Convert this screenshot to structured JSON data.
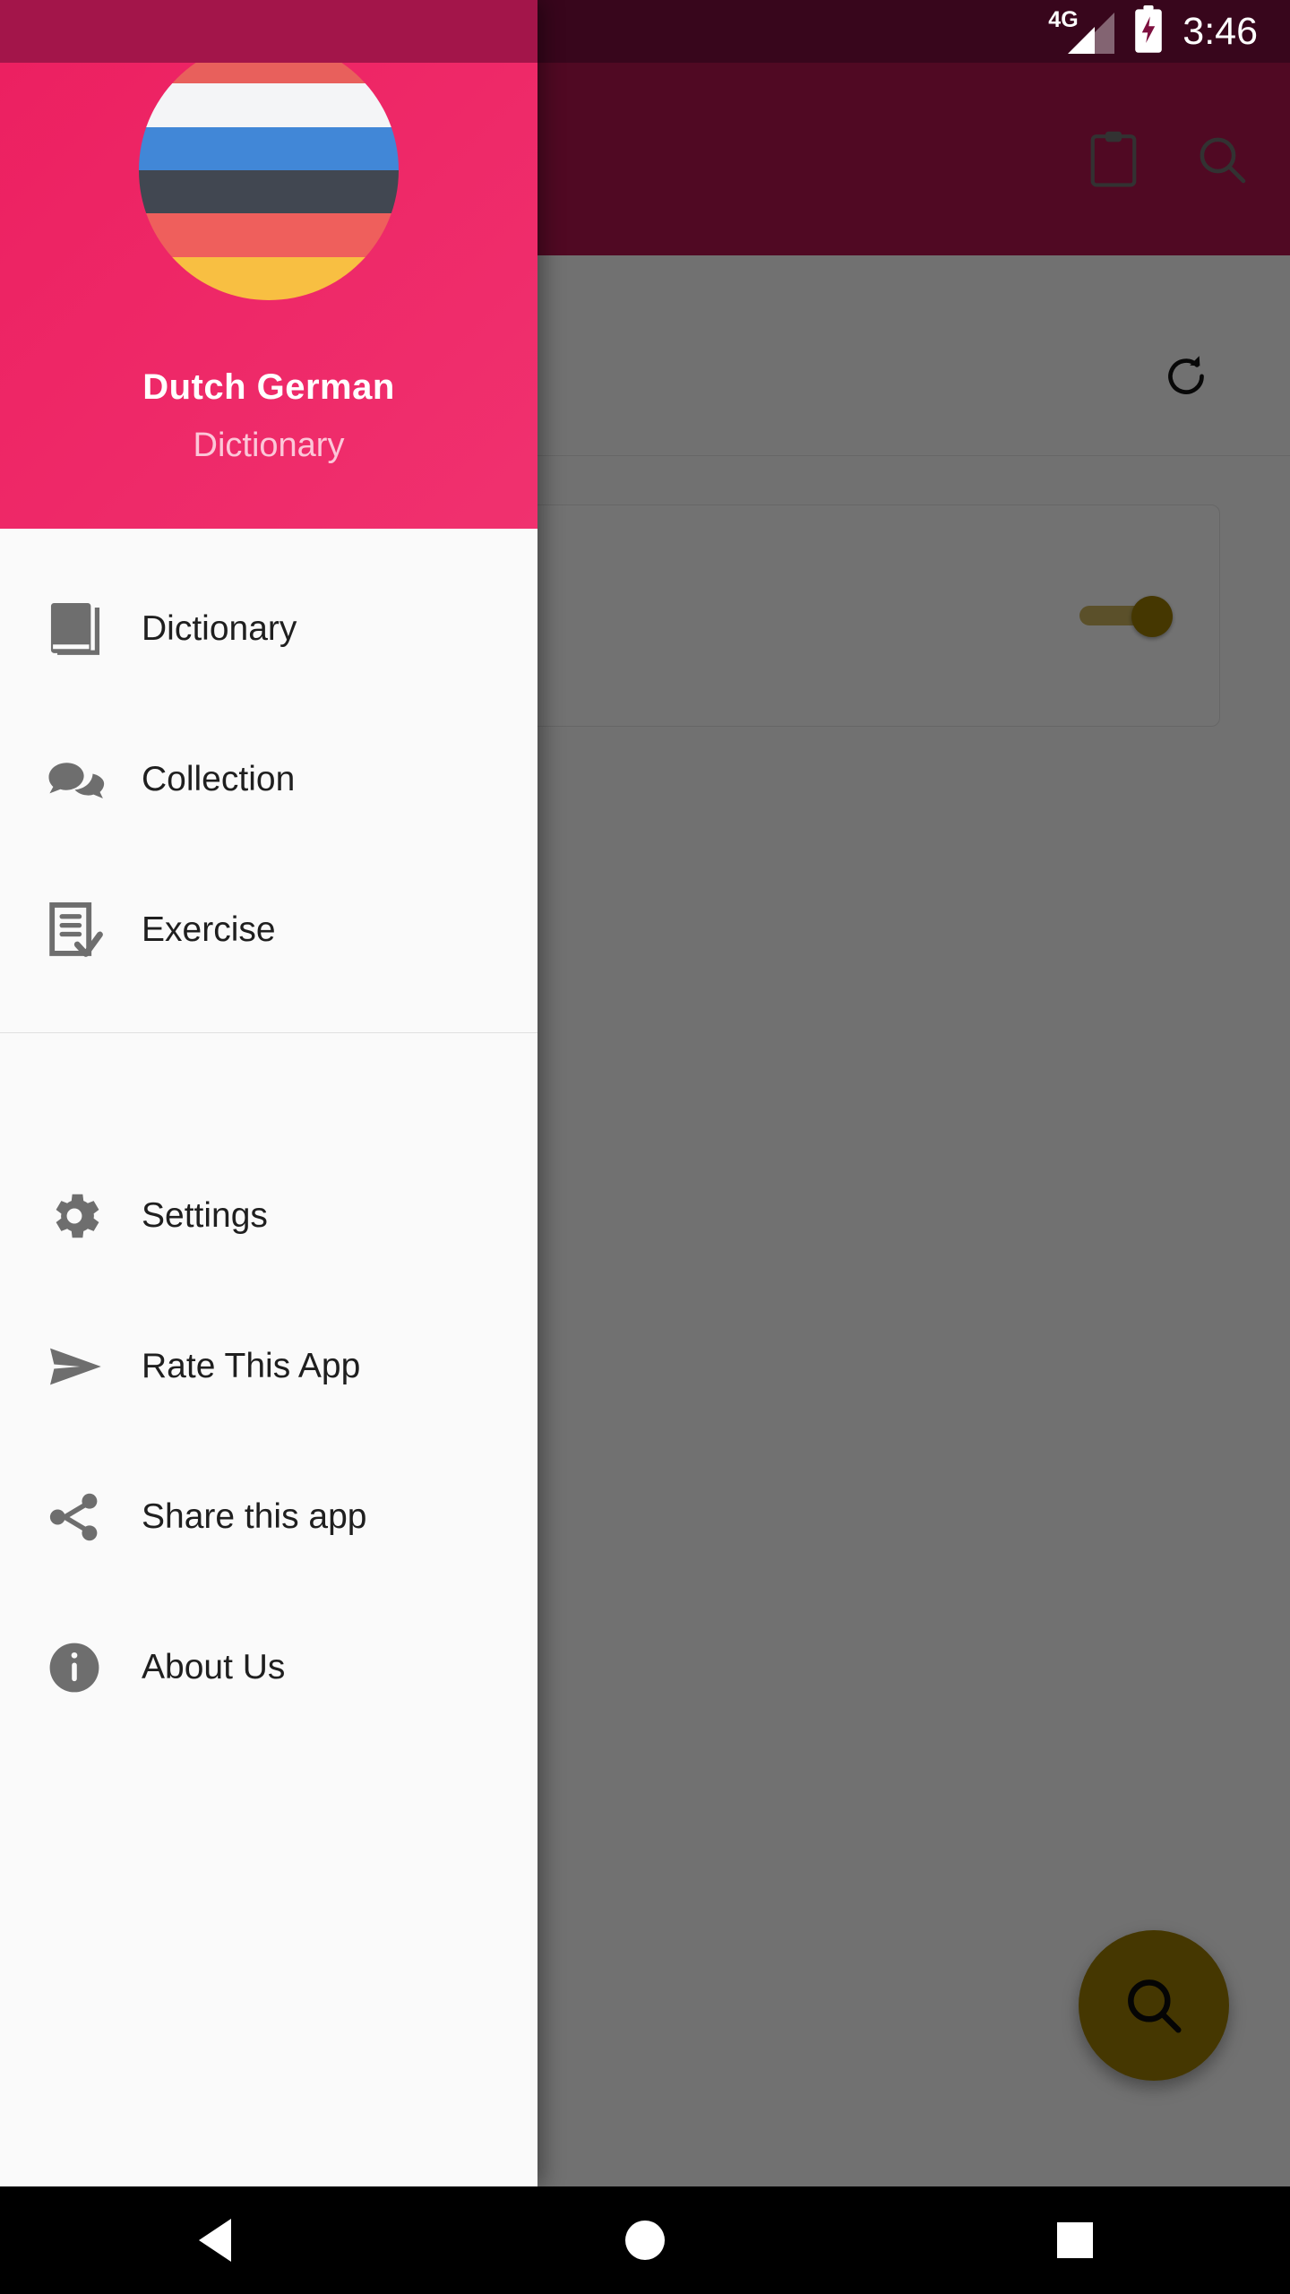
{
  "status_bar": {
    "network": "4G",
    "battery_icon": "battery-charging-icon",
    "time": "3:46"
  },
  "background_app": {
    "appbar": {
      "actions": [
        {
          "name": "clipboard-icon",
          "label": "Clipboard"
        },
        {
          "name": "search-icon",
          "label": "Search"
        }
      ]
    },
    "toolbar": {
      "refresh_label": "Refresh"
    },
    "card": {
      "toggle_state": "on",
      "toggle_color": "#9a7b03"
    },
    "fab": {
      "name": "search-fab",
      "label": "Search",
      "color": "#9a7b03"
    }
  },
  "drawer": {
    "header": {
      "title": "Dutch  German",
      "subtitle": "Dictionary",
      "background_color": "#ed2263",
      "avatar_name": "dutch-german-flag-avatar",
      "flag_stripes": [
        "#e8605c",
        "#f4f5f7",
        "#4187d7",
        "#414751",
        "#ef5f5c",
        "#f8bf42"
      ]
    },
    "primary_items": [
      {
        "id": "dictionary",
        "label": "Dictionary",
        "icon": "book-icon"
      },
      {
        "id": "collection",
        "label": "Collection",
        "icon": "chat-bubbles-icon"
      },
      {
        "id": "exercise",
        "label": "Exercise",
        "icon": "document-check-icon"
      }
    ],
    "secondary_items": [
      {
        "id": "settings",
        "label": "Settings",
        "icon": "gear-icon"
      },
      {
        "id": "rate",
        "label": "Rate This App",
        "icon": "send-icon"
      },
      {
        "id": "share",
        "label": "Share this app",
        "icon": "share-icon"
      },
      {
        "id": "about",
        "label": "About Us",
        "icon": "info-icon"
      }
    ]
  },
  "navigation_bar": {
    "buttons": [
      {
        "name": "back-button",
        "label": "Back"
      },
      {
        "name": "home-button",
        "label": "Home"
      },
      {
        "name": "recents-button",
        "label": "Recents"
      }
    ]
  }
}
